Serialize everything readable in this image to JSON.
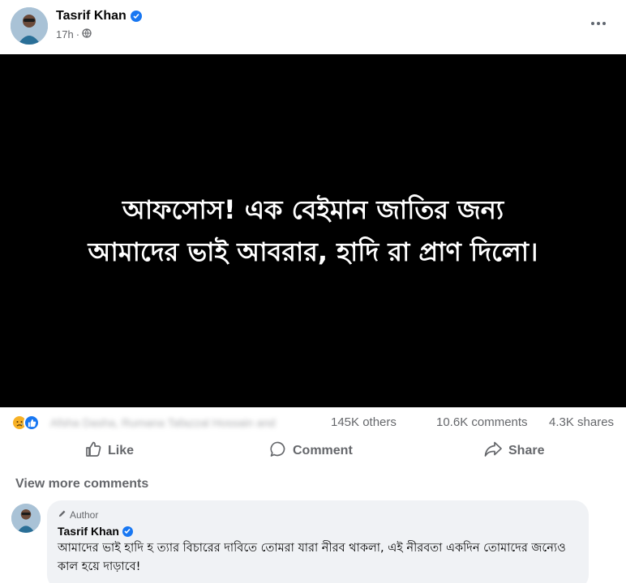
{
  "post": {
    "author": "Tasrif Khan",
    "time": "17h",
    "time_separator": "·",
    "image_text": {
      "line1": "আফসোস! এক বেইমান জাতির জন্য",
      "line2": "আমাদের ভাই আবরার, হাদি রা প্রাণ দিলো।"
    }
  },
  "reactions": {
    "reactors_blurred": "Afsha Dasha, Rumana Tafazzal Hossain and",
    "others": "145K others",
    "comments": "10.6K comments",
    "shares": "4.3K shares"
  },
  "actions": {
    "like": "Like",
    "comment": "Comment",
    "share": "Share"
  },
  "view_more_comments": "View more comments",
  "comment": {
    "badge": "Author",
    "author": "Tasrif Khan",
    "text": "আমাদের ভাই হাদি হ ত্যার বিচারের দাবিতে তোমরা যারা নীরব থাকলা, এই নীরবতা একদিন তোমাদের জন্যেও কাল হয়ে দাড়াবে!"
  },
  "colors": {
    "verified_blue": "#1877f2",
    "secondary_text": "#65676b",
    "comment_bg": "#f0f2f5",
    "image_bg": "#000000"
  },
  "icons": [
    "verified-icon",
    "globe-icon",
    "more-icon",
    "sad-reaction-icon",
    "like-reaction-icon",
    "like-icon",
    "comment-icon",
    "share-icon",
    "pencil-icon"
  ]
}
